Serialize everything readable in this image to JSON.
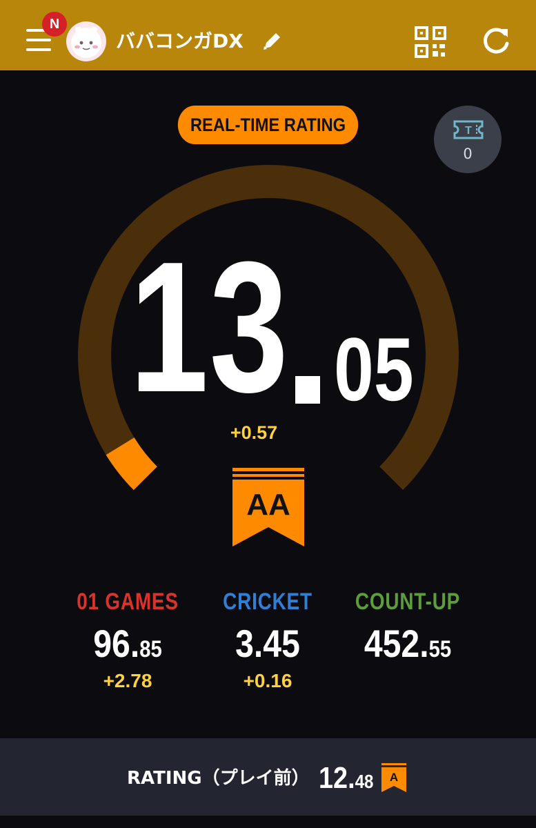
{
  "header": {
    "notification_badge": "N",
    "user_name": "ババコンガDX",
    "icons": [
      "menu-icon",
      "avatar",
      "edit-pencil-icon",
      "qr-code-icon",
      "refresh-icon"
    ]
  },
  "realtime": {
    "label": "REAL-TIME RATING",
    "ticket_count": "0",
    "rating_int": "13",
    "rating_dec": "05",
    "rating_delta": "+0.57",
    "grade": "AA",
    "gauge_fill_fraction": 0.05
  },
  "stats": [
    {
      "label": "01 GAMES",
      "value_int": "96.",
      "value_dec": "85",
      "delta": "+2.78",
      "color": "#d9342b"
    },
    {
      "label": "CRICKET",
      "value_int": "3.45",
      "value_dec": "",
      "delta": "+0.16",
      "color": "#2f7fd6"
    },
    {
      "label": "COUNT-UP",
      "value_int": "452.",
      "value_dec": "55",
      "delta": "",
      "color": "#5e9e3a"
    }
  ],
  "footer": {
    "label": "RATING（プレイ前）",
    "value_int": "12.",
    "value_dec": "48",
    "grade": "A"
  },
  "colors": {
    "header_bg": "#b8860b",
    "accent_orange": "#fe8a00",
    "gauge_track": "#4b2e0a",
    "delta_yellow": "#ffd23b",
    "background": "#0c0c10",
    "footer_bg": "#232631"
  }
}
